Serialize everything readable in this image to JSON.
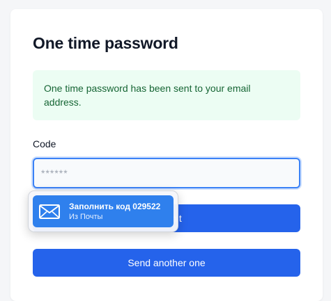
{
  "page": {
    "title": "One time password"
  },
  "alert": {
    "message": "One time password has been sent to your email address."
  },
  "form": {
    "code_label": "Code",
    "code_placeholder": "******",
    "code_value": "",
    "submit_label": "Submit",
    "resend_label": "Send another one"
  },
  "autofill": {
    "title": "Заполнить код 029522",
    "subtitle": "Из Почты",
    "icon": "mail-icon"
  },
  "colors": {
    "primary": "#2563eb",
    "alert_bg": "#ecfdf3",
    "alert_text": "#166534",
    "autofill_bg": "#2f80ed"
  }
}
